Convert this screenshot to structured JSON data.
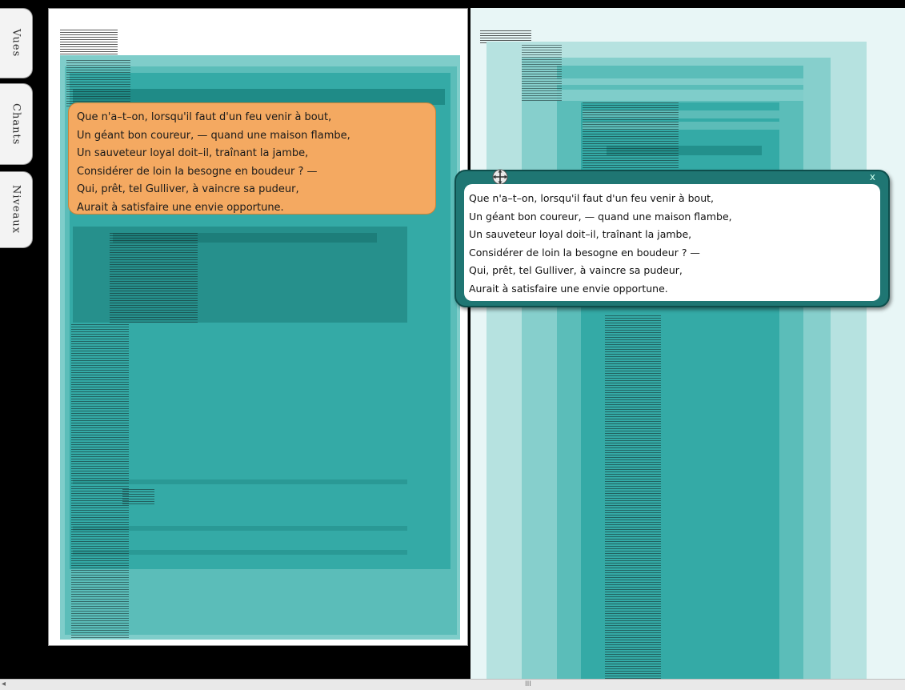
{
  "tabs": [
    "Vues",
    "Chants",
    "Niveaux"
  ],
  "stanza_lines": [
    "Que n'a–t–on, lorsqu'il faut d'un feu venir à bout,",
    "Un géant bon coureur, — quand une maison flambe,",
    "Un sauveteur loyal doit–il, traînant la jambe,",
    "Considérer de loin la besogne en boudeur ? —",
    "Qui, prêt, tel Gulliver, à vaincre sa pudeur,",
    "Aurait à satisfaire une envie opportune."
  ],
  "popup": {
    "close_label": "x"
  },
  "scrollbar": {
    "grip": "III",
    "left_arrow": "◂"
  },
  "colors": {
    "teal_light": "#7fcdca",
    "teal_mid": "#5bbdb9",
    "teal_main": "#34aaa6",
    "teal_dark": "#1f7673",
    "highlight": "#f4a961",
    "panel_bg": "#e8f6f6"
  },
  "icons": {
    "move": "move-cross-icon",
    "close": "close-icon"
  }
}
